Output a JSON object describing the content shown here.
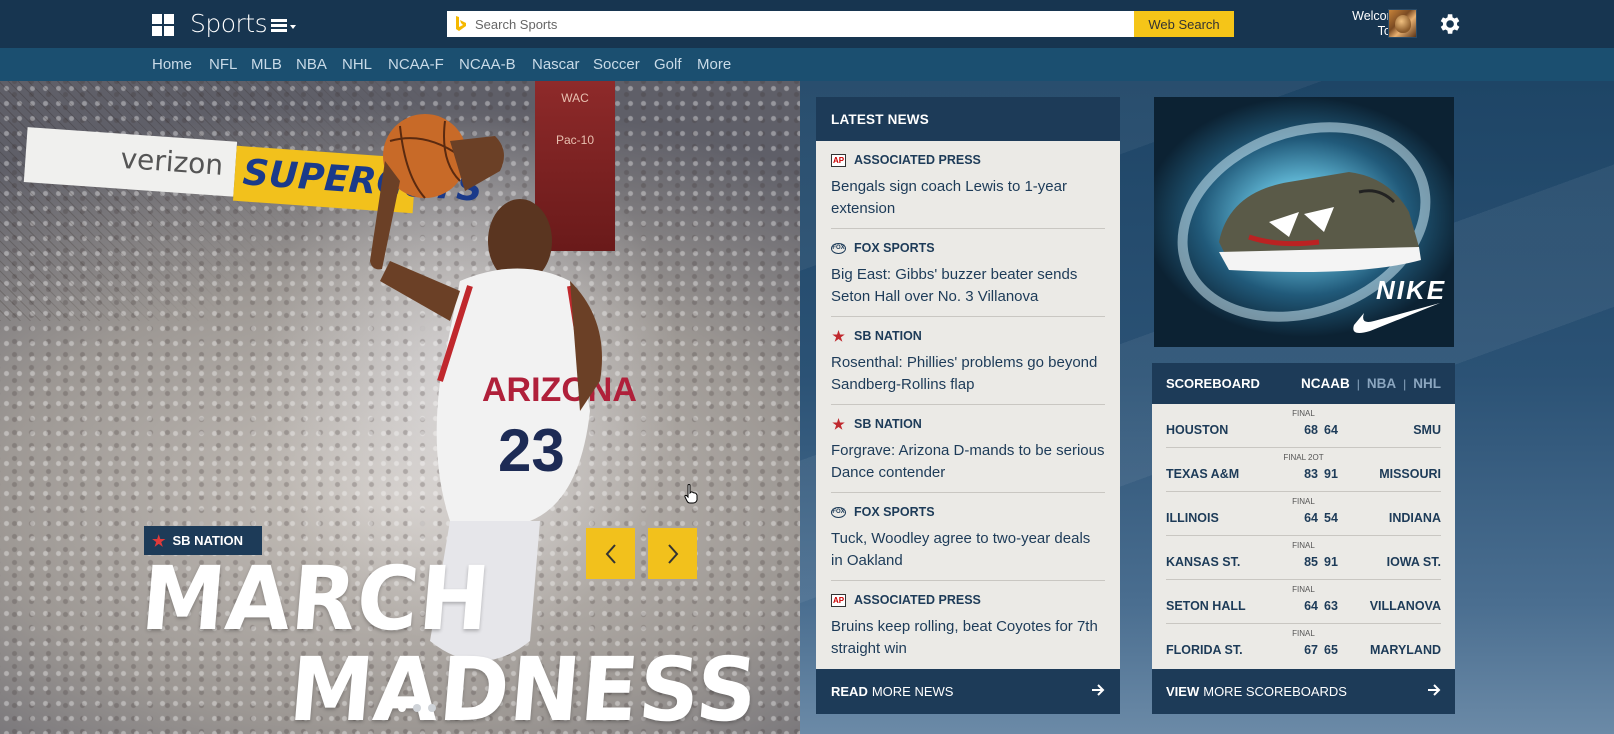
{
  "app": {
    "title": "Sports"
  },
  "search": {
    "placeholder": "Search Sports",
    "button_label": "Web Search"
  },
  "user": {
    "welcome": "Welcome",
    "name": "Tony"
  },
  "nav": {
    "items": [
      "Home",
      "NFL",
      "MLB",
      "NBA",
      "NHL",
      "NCAA-F",
      "NCAA-B",
      "Nascar",
      "Soccer",
      "Golf",
      "More"
    ]
  },
  "hero": {
    "source": "SB NATION",
    "headline_line1": "MARCH",
    "headline_line2": "MADNESS",
    "slide_count": 3,
    "active_slide": 1,
    "backdrop_text": {
      "verizon": "verizon",
      "supercuts": "SUPERCUTS",
      "wac": "WAC",
      "pac10": "Pac-10",
      "jersey": "ARIZONA",
      "number": "23"
    }
  },
  "latest_news": {
    "heading": "LATEST NEWS",
    "items": [
      {
        "source": "ASSOCIATED PRESS",
        "icon": "ap-icon",
        "title": "Bengals sign coach Lewis to 1-year extension"
      },
      {
        "source": "FOX SPORTS",
        "icon": "fox-icon",
        "title": "Big East: Gibbs' buzzer beater sends Seton Hall over No. 3 Villanova"
      },
      {
        "source": "SB NATION",
        "icon": "star-icon",
        "title": "Rosenthal: Phillies' problems go beyond Sandberg-Rollins flap"
      },
      {
        "source": "SB NATION",
        "icon": "star-icon",
        "title": "Forgrave: Arizona D-mands to be serious Dance contender"
      },
      {
        "source": "FOX SPORTS",
        "icon": "fox-icon",
        "title": "Tuck, Woodley agree to two-year deals in Oakland"
      },
      {
        "source": "ASSOCIATED PRESS",
        "icon": "ap-icon",
        "title": "Bruins keep rolling, beat Coyotes for 7th straight win"
      }
    ],
    "footer_bold": "READ",
    "footer_rest": "MORE NEWS"
  },
  "ad": {
    "brand": "NIKE"
  },
  "scoreboard": {
    "heading": "SCOREBOARD",
    "tabs": [
      "NCAAB",
      "NBA",
      "NHL"
    ],
    "active_tab": "NCAAB",
    "games": [
      {
        "status": "FINAL",
        "home": "HOUSTON",
        "home_score": "68",
        "away_score": "64",
        "away": "SMU"
      },
      {
        "status": "FINAL 2OT",
        "home": "TEXAS A&M",
        "home_score": "83",
        "away_score": "91",
        "away": "MISSOURI"
      },
      {
        "status": "FINAL",
        "home": "ILLINOIS",
        "home_score": "64",
        "away_score": "54",
        "away": "INDIANA"
      },
      {
        "status": "FINAL",
        "home": "KANSAS ST.",
        "home_score": "85",
        "away_score": "91",
        "away": "IOWA ST."
      },
      {
        "status": "FINAL",
        "home": "SETON HALL",
        "home_score": "64",
        "away_score": "63",
        "away": "VILLANOVA"
      },
      {
        "status": "FINAL",
        "home": "FLORIDA ST.",
        "home_score": "67",
        "away_score": "65",
        "away": "MARYLAND"
      }
    ],
    "footer_bold": "VIEW",
    "footer_rest": "MORE SCOREBOARDS"
  },
  "colors": {
    "brand_dark": "#1d3b58",
    "nav_bg": "#1b4f70",
    "accent_yellow": "#f2c11c",
    "panel_bg": "#ebeae6",
    "sbnation_red": "#c0282d"
  }
}
